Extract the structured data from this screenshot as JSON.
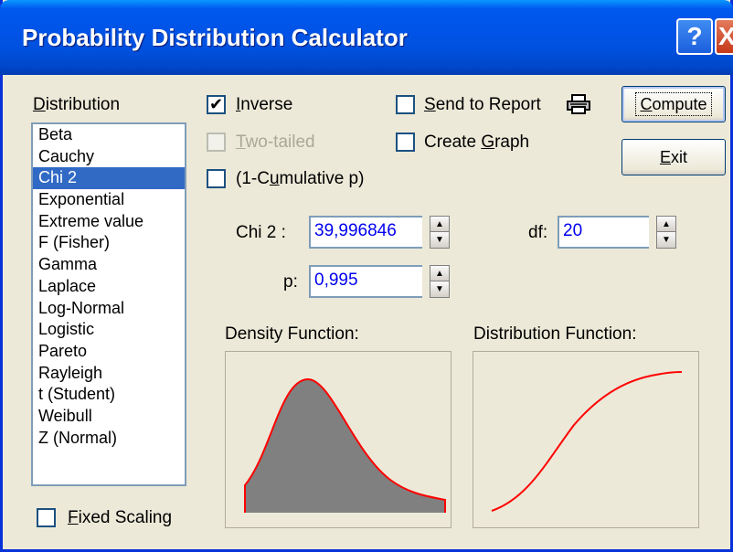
{
  "window": {
    "title": "Probability Distribution Calculator",
    "help_glyph": "?",
    "close_glyph": "X"
  },
  "distribution": {
    "label": "Distribution",
    "items": [
      "Beta",
      "Cauchy",
      "Chi 2",
      "Exponential",
      "Extreme value",
      "F (Fisher)",
      "Gamma",
      "Laplace",
      "Log-Normal",
      "Logistic",
      "Pareto",
      "Rayleigh",
      "t (Student)",
      "Weibull",
      "Z (Normal)"
    ],
    "selected": "Chi 2"
  },
  "options": {
    "inverse": {
      "label": "Inverse",
      "checked": true
    },
    "two_tailed": {
      "label": "Two-tailed",
      "checked": false,
      "disabled": true
    },
    "one_minus_cumulative": {
      "label": "(1-Cumulative p)",
      "checked": false
    },
    "send_to_report": {
      "label": "Send to Report",
      "checked": false
    },
    "create_graph": {
      "label": "Create Graph",
      "checked": false
    },
    "fixed_scaling": {
      "label": "Fixed Scaling",
      "checked": false
    },
    "check_glyph": "✔"
  },
  "buttons": {
    "compute": "Compute",
    "exit": "Exit"
  },
  "inputs": {
    "chi2": {
      "label": "Chi 2 :",
      "value": "39,996846"
    },
    "df": {
      "label": "df:",
      "value": "20"
    },
    "p": {
      "label": "p:",
      "value": "0,995"
    }
  },
  "plots": {
    "density_label": "Density Function:",
    "distribution_label": "Distribution Function:"
  },
  "colors": {
    "accent": "#316ac5",
    "curve": "#ff0000",
    "fill": "#808080",
    "value_text": "#0000ee"
  }
}
